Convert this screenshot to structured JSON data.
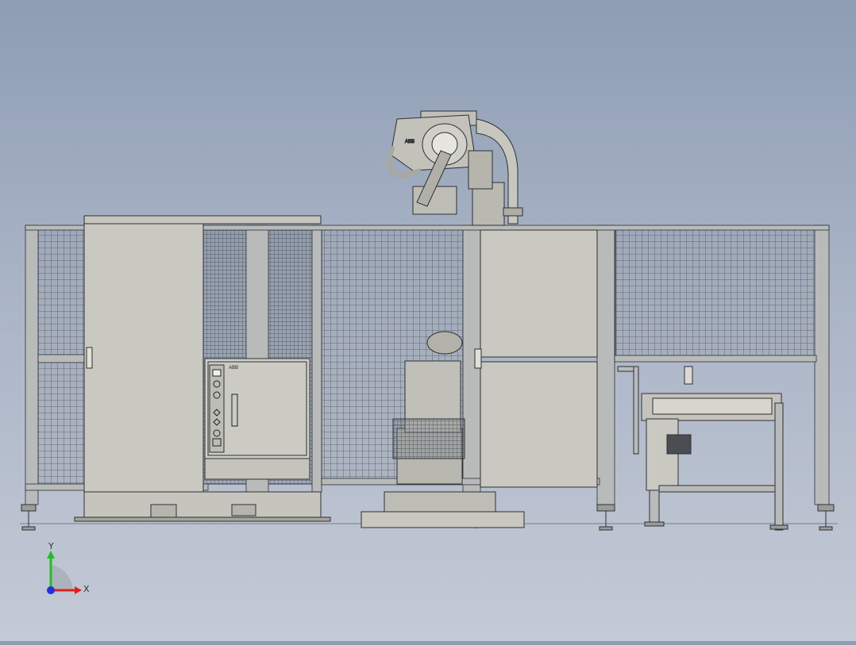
{
  "viewport": {
    "background_top": "#8e9db4",
    "background_bottom": "#c4cad6",
    "model": {
      "frame_color": "#9fa3a2",
      "panel_color": "#c8c8c0",
      "mesh_color": "#555a60",
      "line_color": "#2e3033",
      "robot_brand": "ABB",
      "controller_brand": "ABB"
    }
  },
  "triad": {
    "x_label": "X",
    "y_label": "Y",
    "x_color": "#e02020",
    "y_color": "#20c020",
    "z_color": "#2030e0"
  }
}
